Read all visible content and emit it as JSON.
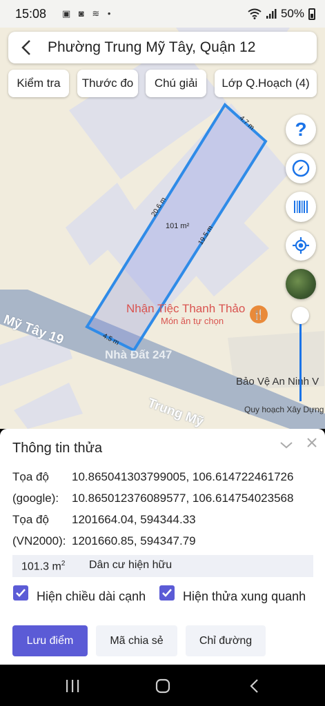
{
  "status": {
    "time": "15:08",
    "icons": [
      "image-icon",
      "app-icon",
      "signal-icon",
      "dot"
    ],
    "battery": "50%"
  },
  "search": {
    "title": "Phường Trung Mỹ Tây, Quận 12"
  },
  "chips": [
    "Kiểm tra",
    "Thước đo",
    "Chú giải",
    "Lớp Q.Hoạch (4)"
  ],
  "map": {
    "parcel_area": "101 m²",
    "edges": {
      "top": "4.7 m",
      "left": "20.6 m",
      "right": "19.5 m",
      "bottom": "4.5 m"
    },
    "poi_name": "Nhận Tiệc Thanh Thảo",
    "poi_sub": "Món ăn tự chọn",
    "road_1": "Mỹ Tây 19",
    "road_2": "Trung Mỹ",
    "place": "Bảo Vệ An Ninh V",
    "watermark": "Nhà Đất 247"
  },
  "side_buttons": {
    "help": "?",
    "slider_label": "Quy hoạch Xây Dựng"
  },
  "info": {
    "title": "Thông tin thửa",
    "rows": [
      {
        "label": "Tọa độ",
        "value": "10.865041303799005, 106.614722461726"
      },
      {
        "label": "(google):",
        "value": "10.865012376089577, 106.614754023568"
      },
      {
        "label": "Tọa độ",
        "value": "1201664.04, 594344.33"
      },
      {
        "label": "(VN2000):",
        "value": "1201660.85, 594347.79"
      }
    ],
    "area_value": "101.3 m",
    "area_unit_sup": "2",
    "area_type": "Dân cư hiện hữu",
    "check_1": "Hiện chiều dài cạnh",
    "check_2": "Hiện thửa xung quanh",
    "buttons": {
      "save": "Lưu điểm",
      "share": "Mã chia sẻ",
      "directions": "Chỉ đường"
    }
  },
  "colors": {
    "accent": "#5b5bd6",
    "parcel_stroke": "#2f8be8",
    "map_blue": "#1a73e8",
    "poi": "#d9534f"
  }
}
